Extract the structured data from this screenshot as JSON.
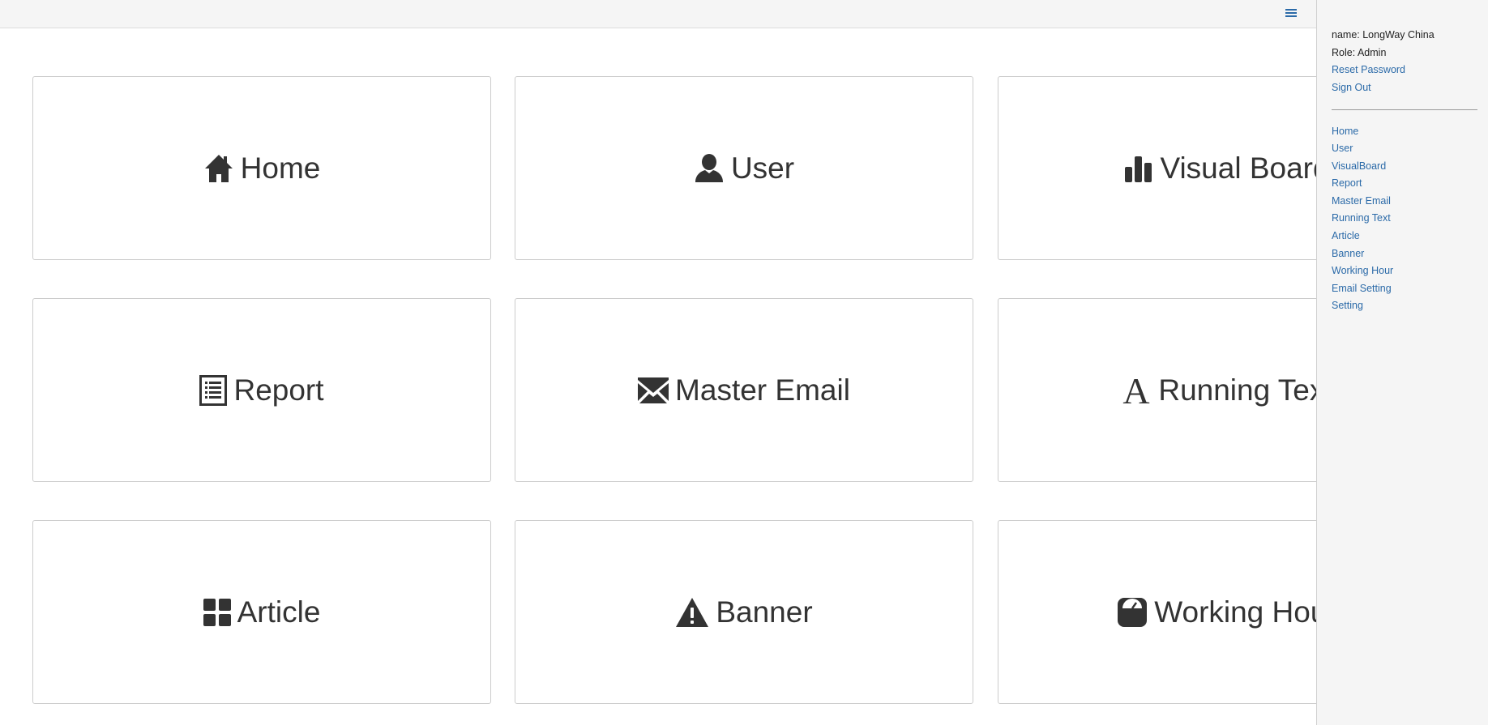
{
  "topbar": {
    "menu_icon": "hamburger-icon"
  },
  "tiles": [
    {
      "label": "Home",
      "icon": "home-icon"
    },
    {
      "label": "User",
      "icon": "user-icon"
    },
    {
      "label": "Visual Board",
      "icon": "bar-chart-icon"
    },
    {
      "label": "Report",
      "icon": "list-icon"
    },
    {
      "label": "Master Email",
      "icon": "envelope-icon"
    },
    {
      "label": "Running Text",
      "icon": "font-icon"
    },
    {
      "label": "Article",
      "icon": "grid-icon"
    },
    {
      "label": "Banner",
      "icon": "warning-icon"
    },
    {
      "label": "Working Hour",
      "icon": "dashboard-icon"
    }
  ],
  "sidebar": {
    "name_text": "name: LongWay China",
    "role_text": "Role: Admin",
    "reset_password": "Reset Password",
    "sign_out": "Sign Out",
    "nav": [
      "Home",
      "User",
      "VisualBoard",
      "Report",
      "Master Email",
      "Running Text",
      "Article",
      "Banner",
      "Working Hour",
      "Email Setting",
      "Setting"
    ]
  },
  "colors": {
    "link": "#2b6aa8",
    "topbar_bg": "#f5f5f5",
    "sidebar_bg": "#f5f5f5",
    "tile_border": "#cccccc",
    "text": "#333333"
  }
}
